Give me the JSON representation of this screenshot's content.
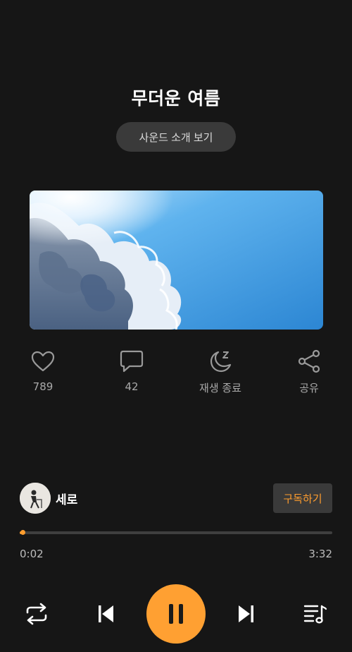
{
  "track": {
    "title": "무더운 여름",
    "intro_button_label": "사운드 소개 보기"
  },
  "actions": {
    "like": {
      "icon": "heart-icon",
      "label": "789"
    },
    "comment": {
      "icon": "comment-icon",
      "label": "42"
    },
    "sleep_timer": {
      "icon": "moon-sleep-icon",
      "label": "재생 종료"
    },
    "share": {
      "icon": "share-icon",
      "label": "공유"
    }
  },
  "artist": {
    "name": "세로",
    "subscribe_label": "구독하기"
  },
  "playback": {
    "current_time": "0:02",
    "total_time": "3:32",
    "progress_fraction": 0.01
  },
  "controls": {
    "repeat": "repeat-icon",
    "previous": "skip-previous-icon",
    "play_pause": "pause-icon",
    "next": "skip-next-icon",
    "playlist": "playlist-icon"
  },
  "colors": {
    "accent": "#ffa032",
    "background": "#161616",
    "chip": "#3a3a3a"
  }
}
